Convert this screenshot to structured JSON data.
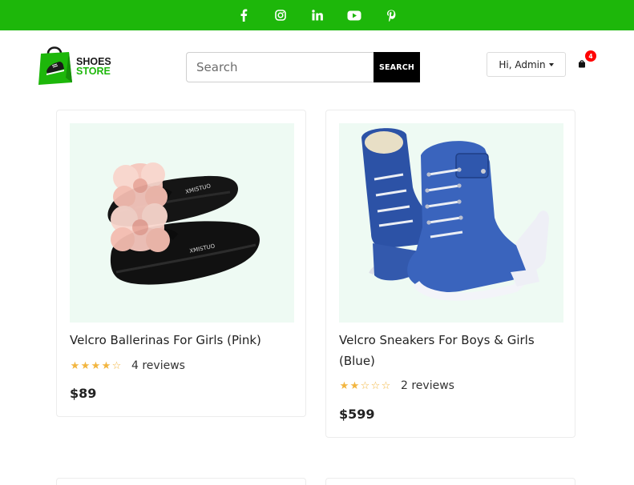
{
  "social": [
    {
      "name": "facebook-icon"
    },
    {
      "name": "instagram-icon"
    },
    {
      "name": "linkedin-icon"
    },
    {
      "name": "youtube-icon"
    },
    {
      "name": "pinterest-icon"
    }
  ],
  "brand": {
    "line1": "SHOES",
    "line2": "STORE",
    "color_primary": "#1db70a",
    "color_dark": "#1a1a1a"
  },
  "search": {
    "placeholder": "Search",
    "value": "",
    "button_label": "SEARCH"
  },
  "user": {
    "greeting": "Hi, Admin"
  },
  "cart": {
    "count": "4",
    "icon": "shopping-bag-icon"
  },
  "products": [
    {
      "title": "Velcro Ballerinas For Girls (Pink)",
      "rating": 4,
      "max_rating": 5,
      "reviews": "4 reviews",
      "price": "$89"
    },
    {
      "title": "Velcro Sneakers For Boys & Girls (Blue)",
      "rating": 2,
      "max_rating": 5,
      "reviews": "2 reviews",
      "price": "$599"
    }
  ],
  "colors": {
    "topbar": "#1db70a",
    "star": "#f2b53f",
    "badge": "#ff0000",
    "image_bg": "#eefaf3"
  }
}
